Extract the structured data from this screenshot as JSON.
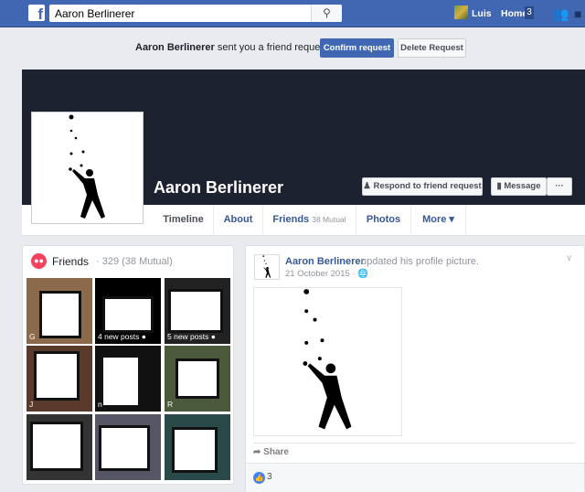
{
  "topbar": {
    "search_value": "Aaron Berlinerer",
    "user_name": "Luis",
    "home_label": "Home",
    "home_count": "3",
    "brand_color": "#4267b2"
  },
  "request": {
    "name": "Aaron Berlinerer",
    "text": "sent you a friend request",
    "confirm": "Confirm request",
    "delete": "Delete Request"
  },
  "profile": {
    "name": "Aaron Berlinerer",
    "respond": "Respond to friend request",
    "message": "Message",
    "more_dots": "···"
  },
  "tabs": [
    {
      "label": "Timeline"
    },
    {
      "label": "About"
    },
    {
      "label": "Friends",
      "sub": "38 Mutual"
    },
    {
      "label": "Photos"
    },
    {
      "label": "More ▾"
    }
  ],
  "friends": {
    "title": "Friends",
    "count": "· 329 (38 Mutual)",
    "tiles": [
      {
        "label": "G",
        "bg": "#8a6a4a"
      },
      {
        "label": "4 new posts ●",
        "bg": "#000"
      },
      {
        "label": "5 new posts ●",
        "bg": "#222"
      },
      {
        "label": "J",
        "bg": "#5a3a2a"
      },
      {
        "label": "n",
        "bg": "#111"
      },
      {
        "label": "R",
        "bg": "#4a5a3a"
      },
      {
        "label": "",
        "bg": "#333"
      },
      {
        "label": "",
        "bg": "#556"
      },
      {
        "label": "",
        "bg": "#2a4a4a"
      }
    ]
  },
  "post": {
    "author": "Aaron Berlinerer",
    "action": "updated his profile picture.",
    "date": "21 October 2015 · 🌐",
    "share": "Share",
    "likes": "3"
  }
}
